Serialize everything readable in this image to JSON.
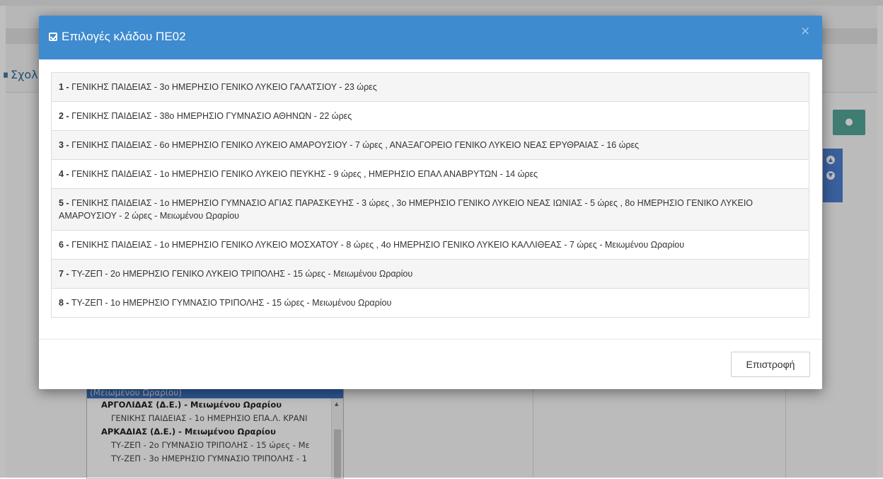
{
  "background": {
    "heading": "Σχολ",
    "list": {
      "selected_text": "(Μειωμένου Ωραρίου)",
      "items": [
        {
          "text": "ΑΡΓΟΛΙΔΑΣ (Δ.Ε.) - Μειωμένου Ωραρίου",
          "kind": "group"
        },
        {
          "text": "ΓΕΝΙΚΗΣ ΠΑΙΔΕΙΑΣ - 1ο ΗΜΕΡΗΣΙΟ ΕΠΑ.Λ. ΚΡΑΝΙ",
          "kind": "sub"
        },
        {
          "text": "ΑΡΚΑΔΙΑΣ (Δ.Ε.) - Μειωμένου Ωραρίου",
          "kind": "group"
        },
        {
          "text": "ΤΥ-ΖΕΠ - 2ο ΓΥΜΝΑΣΙΟ ΤΡΙΠΟΛΗΣ - 15 ώρες - Με",
          "kind": "sub"
        },
        {
          "text": "ΤΥ-ΖΕΠ - 3ο ΗΜΕΡΗΣΙΟ ΓΥΜΝΑΣΙΟ ΤΡΙΠΟΛΗΣ - 1",
          "kind": "sub"
        }
      ]
    }
  },
  "modal": {
    "title": "Επιλογές κλάδου ΠΕ02",
    "close": "×",
    "options": [
      {
        "num": "1 -",
        "text": " ΓΕΝΙΚΗΣ ΠΑΙΔΕΙΑΣ - 3ο ΗΜΕΡΗΣΙΟ ΓΕΝΙΚΟ ΛΥΚΕΙΟ ΓΑΛΑΤΣΙΟΥ - 23 ώρες"
      },
      {
        "num": "2 -",
        "text": " ΓΕΝΙΚΗΣ ΠΑΙΔΕΙΑΣ - 38ο ΗΜΕΡΗΣΙΟ ΓΥΜΝΑΣΙΟ ΑΘΗΝΩΝ - 22 ώρες"
      },
      {
        "num": "3 -",
        "text": " ΓΕΝΙΚΗΣ ΠΑΙΔΕΙΑΣ - 6ο ΗΜΕΡΗΣΙΟ ΓΕΝΙΚΟ ΛΥΚΕΙΟ ΑΜΑΡΟΥΣΙΟΥ - 7 ώρες , ΑΝΑΞΑΓΟΡΕΙΟ ΓΕΝΙΚΟ ΛΥΚΕΙΟ ΝΕΑΣ ΕΡΥΘΡΑΙΑΣ - 16 ώρες"
      },
      {
        "num": "4 -",
        "text": " ΓΕΝΙΚΗΣ ΠΑΙΔΕΙΑΣ - 1ο ΗΜΕΡΗΣΙΟ ΓΕΝΙΚΟ ΛΥΚΕΙΟ ΠΕΥΚΗΣ - 9 ώρες , ΗΜΕΡΗΣΙΟ ΕΠΑΛ ΑΝΑΒΡΥΤΩΝ - 14 ώρες"
      },
      {
        "num": "5 -",
        "text": " ΓΕΝΙΚΗΣ ΠΑΙΔΕΙΑΣ - 1ο ΗΜΕΡΗΣΙΟ ΓΥΜΝΑΣΙΟ ΑΓΙΑΣ ΠΑΡΑΣΚΕΥΗΣ - 3 ώρες , 3ο ΗΜΕΡΗΣΙΟ ΓΕΝΙΚΟ ΛΥΚΕΙΟ ΝΕΑΣ ΙΩΝΙΑΣ - 5 ώρες , 8ο ΗΜΕΡΗΣΙΟ ΓΕΝΙΚΟ ΛΥΚΕΙΟ ΑΜΑΡΟΥΣΙΟΥ - 2 ώρες - Μειωμένου Ωραρίου"
      },
      {
        "num": "6 -",
        "text": " ΓΕΝΙΚΗΣ ΠΑΙΔΕΙΑΣ - 1ο ΗΜΕΡΗΣΙΟ ΓΕΝΙΚΟ ΛΥΚΕΙΟ ΜΟΣΧΑΤΟΥ - 8 ώρες , 4ο ΗΜΕΡΗΣΙΟ ΓΕΝΙΚΟ ΛΥΚΕΙΟ ΚΑΛΛΙΘΕΑΣ - 7 ώρες - Μειωμένου Ωραρίου"
      },
      {
        "num": "7 -",
        "text": " ΤΥ-ΖΕΠ - 2ο ΗΜΕΡΗΣΙΟ ΓΕΝΙΚΟ ΛΥΚΕΙΟ ΤΡΙΠΟΛΗΣ - 15 ώρες - Μειωμένου Ωραρίου"
      },
      {
        "num": "8 -",
        "text": " ΤΥ-ΖΕΠ - 1ο ΗΜΕΡΗΣΙΟ ΓΥΜΝΑΣΙΟ ΤΡΙΠΟΛΗΣ - 15 ώρες - Μειωμένου Ωραρίου"
      }
    ],
    "return_label": "Επιστροφή"
  },
  "colors": {
    "modal_header": "#3e8bd0",
    "row_stripe": "#f5f5f5",
    "eye_button": "#54a79a",
    "side_panel": "#4d7fd0"
  },
  "icons": {
    "title_icon": "check-square-icon",
    "eye_button_icon": "eye-icon",
    "panel_icons": [
      "chevron-up-circle-icon",
      "chevron-down-circle-icon"
    ]
  }
}
